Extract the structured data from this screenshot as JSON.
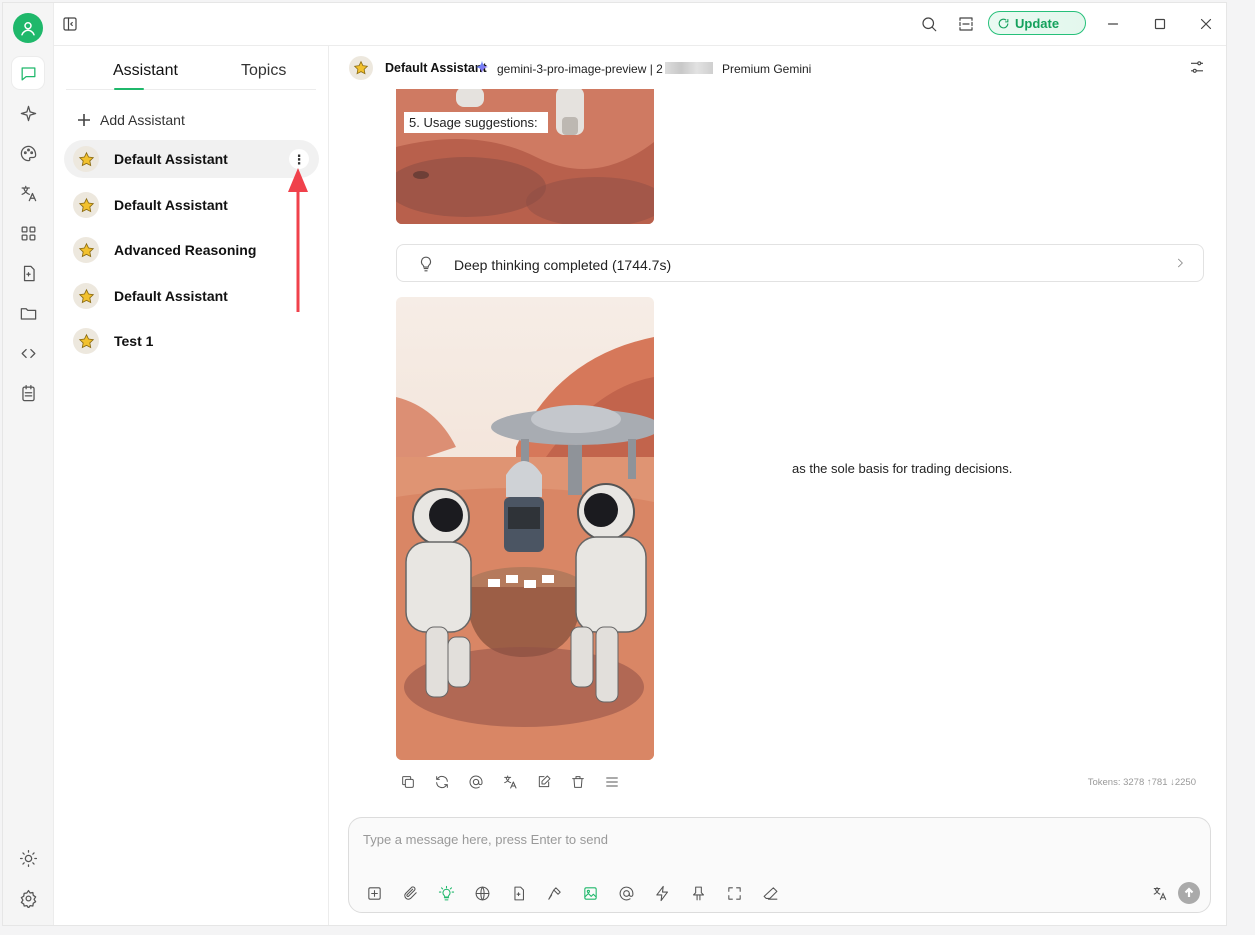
{
  "titlebar": {
    "update_label": "Update"
  },
  "sidebar": {
    "tabs": [
      {
        "label": "Assistant",
        "active": true
      },
      {
        "label": "Topics",
        "active": false
      }
    ],
    "add_assistant_label": "Add Assistant",
    "assistants": [
      {
        "label": "Default Assistant",
        "selected": true
      },
      {
        "label": "Default Assistant",
        "selected": false
      },
      {
        "label": "Advanced Reasoning",
        "selected": false
      },
      {
        "label": "Default Assistant",
        "selected": false
      },
      {
        "label": "Test 1",
        "selected": false
      }
    ],
    "menu_glyph": "⋮"
  },
  "chat": {
    "assistant_name": "Default Assistant",
    "model": "gemini-3-pro-image-preview | 2",
    "provider": "Premium Gemini",
    "image1_caption": "5. Usage suggestions:",
    "thinking_label": "Deep thinking completed (1744.7s)",
    "side_note": "as the sole basis for trading decisions.",
    "tokens": "Tokens: 3278 ↑781 ↓2250",
    "composer_placeholder": "Type a message here, press Enter to send"
  },
  "colors": {
    "accent": "#1fb86b",
    "star": "#f2c12e",
    "arrow": "#f0414b"
  }
}
